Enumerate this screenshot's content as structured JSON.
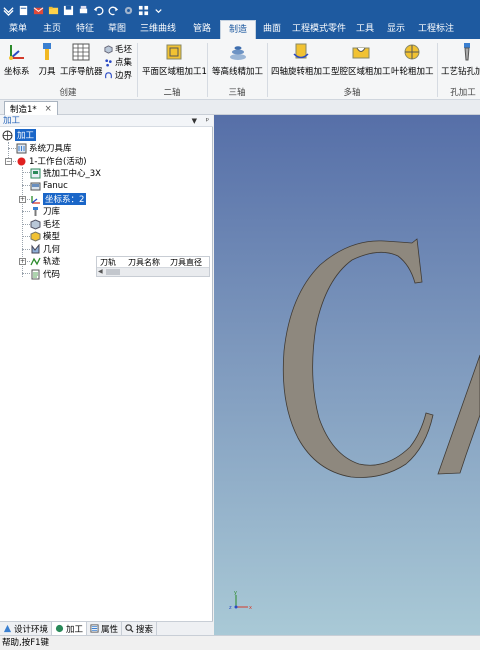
{
  "menu": {
    "tabs": [
      {
        "label": "菜单",
        "active": false
      },
      {
        "label": "主页",
        "active": false
      },
      {
        "label": "特征",
        "active": false
      },
      {
        "label": "草图",
        "active": false
      },
      {
        "label": "三维曲线",
        "active": false
      },
      {
        "label": "管路",
        "active": false
      },
      {
        "label": "制造",
        "active": true
      },
      {
        "label": "曲面",
        "active": false
      },
      {
        "label": "工程模式零件",
        "active": false
      },
      {
        "label": "工具",
        "active": false
      },
      {
        "label": "显示",
        "active": false
      },
      {
        "label": "工程标注",
        "active": false
      }
    ]
  },
  "ribbon": {
    "coord_system": "坐标系",
    "tool": "刀具",
    "process_navigator": "工序导航器",
    "blank": "毛坯",
    "point_set": "点集",
    "boundary": "边界",
    "group_create": "创建",
    "plane_rough": "平面区域粗加工1",
    "group_2axis": "二轴",
    "contour_finish": "等高线精加工",
    "group_3axis": "三轴",
    "rot4_rough": "四轴旋转粗加工",
    "cavity_rough": "型腔区域粗加工",
    "blade_rough": "叶轮粗加工",
    "group_multi": "多轴",
    "hole_process": "工艺钻孔加工",
    "group_hole": "孔加工"
  },
  "doc_tab": {
    "label": "制造1*",
    "close": "×"
  },
  "panel": {
    "title": "加工",
    "dropdown": "▼",
    "pin": "ᵖ"
  },
  "tree": {
    "root": "加工",
    "tool_library": "系统刀具库",
    "workbench": "1-工作台(活动)",
    "machine": "铣加工中心_3X",
    "controller": "Fanuc",
    "coord": "坐标系：2",
    "magazine": "刀库",
    "blank": "毛坯",
    "model": "模型",
    "geometry": "几何",
    "toolpath": "轨迹",
    "code": "代码"
  },
  "tool_table": {
    "headers": [
      "刀轨",
      "刀具名称",
      "刀具直径"
    ]
  },
  "bottom_tabs": [
    {
      "label": "设计环境",
      "active": false
    },
    {
      "label": "加工",
      "active": true
    },
    {
      "label": "属性",
      "active": false
    },
    {
      "label": "搜索",
      "active": false
    }
  ],
  "status": {
    "text": "帮助,按F1键"
  },
  "viewport": {
    "axes": {
      "x": "x",
      "y": "y",
      "z": "z"
    }
  },
  "colors": {
    "titlebar": "#1e5aa0",
    "accent": "#1a66c8",
    "letter_fill": "#8e887e"
  }
}
